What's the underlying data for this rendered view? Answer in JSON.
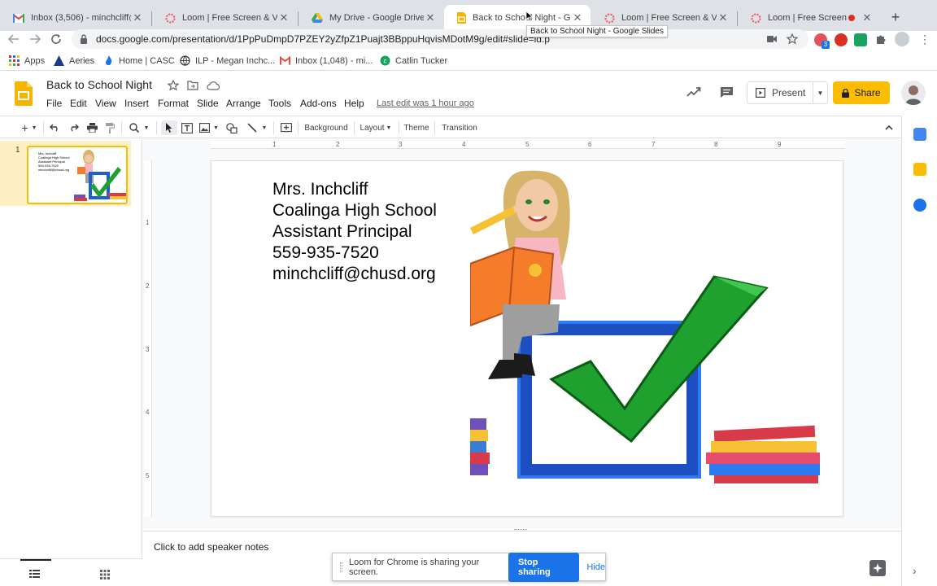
{
  "browser": {
    "tabs": [
      {
        "title": "Inbox (3,506) - minchcliff@c",
        "icon": "gmail-icon"
      },
      {
        "title": "Loom | Free Screen & Video",
        "icon": "loom-icon"
      },
      {
        "title": "My Drive - Google Drive",
        "icon": "drive-icon"
      },
      {
        "title": "Back to School Night - Goog",
        "icon": "slides-icon",
        "active": true
      },
      {
        "title": "Loom | Free Screen & Video",
        "icon": "loom-icon"
      },
      {
        "title": "Loom | Free Screen & Vi",
        "icon": "loom-icon"
      }
    ],
    "tooltip": "Back to School Night - Google Slides",
    "url": "docs.google.com/presentation/d/1PpPuDmpD7PZEY2yZfpZ1Puajt3BBppuHqvisMDotM9g/edit#slide=id.p",
    "extension_badge": "3"
  },
  "bookmarks": [
    {
      "label": "Apps",
      "icon": "apps-grid-icon"
    },
    {
      "label": "Aeries",
      "icon": "aeries-icon"
    },
    {
      "label": "Home | CASC",
      "icon": "casc-icon"
    },
    {
      "label": "ILP - Megan Inchc...",
      "icon": "globe-icon"
    },
    {
      "label": "Inbox (1,048) - mi...",
      "icon": "gmail-icon"
    },
    {
      "label": "Catlin Tucker",
      "icon": "catlin-icon"
    }
  ],
  "slides": {
    "doc_title": "Back to School Night",
    "menus": [
      "File",
      "Edit",
      "View",
      "Insert",
      "Format",
      "Slide",
      "Arrange",
      "Tools",
      "Add-ons",
      "Help"
    ],
    "last_edit": "Last edit was 1 hour ago",
    "present_label": "Present",
    "share_label": "Share",
    "toolbar": {
      "background": "Background",
      "layout": "Layout",
      "theme": "Theme",
      "transition": "Transition"
    },
    "slide_number": "1",
    "slide_lines": [
      "Mrs. Inchcliff",
      "Coalinga High School",
      "Assistant Principal",
      "559-935-7520",
      "minchcliff@chusd.org"
    ],
    "ruler_h": [
      "1",
      "2",
      "3",
      "4",
      "5",
      "6",
      "7",
      "8",
      "9"
    ],
    "ruler_v": [
      "1",
      "2",
      "3",
      "4",
      "5"
    ],
    "notes_placeholder": "Click to add speaker notes"
  },
  "loom": {
    "message": "Loom for Chrome is sharing your screen.",
    "stop_label": "Stop sharing",
    "hide_label": "Hide"
  },
  "colors": {
    "slides_yellow": "#fbbc04",
    "accent_blue": "#1a73e8"
  }
}
